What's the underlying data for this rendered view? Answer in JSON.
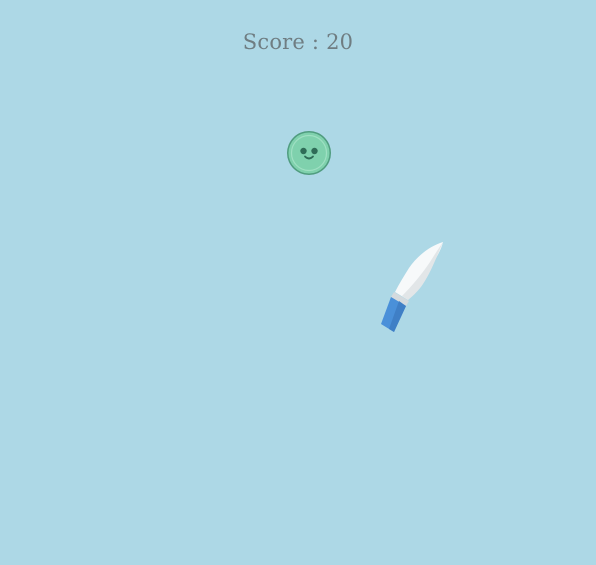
{
  "hud": {
    "score_label": "Score : 20",
    "score_value": 20
  },
  "colors": {
    "background": "#add8e6",
    "score_text": "#6f7d82",
    "target_fill": "#7fd1ad",
    "target_inner": "#6cc7a0",
    "target_ring": "#4f9c7e",
    "target_face": "#2f6c57",
    "knife_blade": "#f7f9fa",
    "knife_blade_shade": "#e2e6e8",
    "knife_handle": "#4a90d9"
  },
  "icons": {
    "target": "smiley-face-target-icon",
    "knife": "knife-icon"
  }
}
